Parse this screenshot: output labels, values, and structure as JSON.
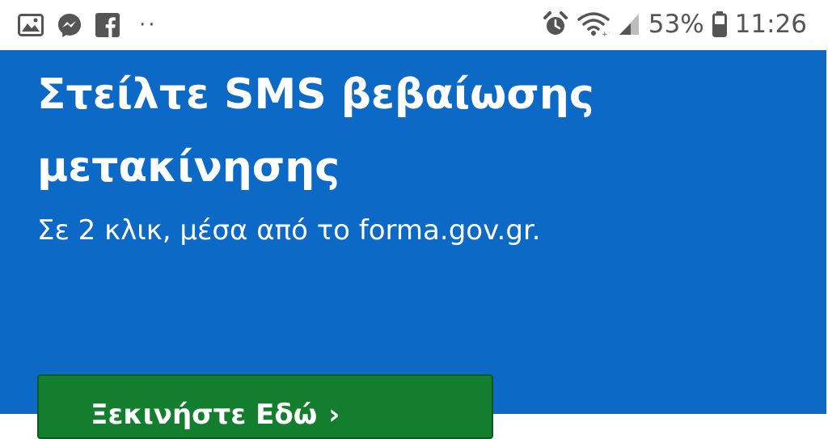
{
  "status_bar": {
    "left_icons": [
      "image-icon",
      "messenger-icon",
      "facebook-icon",
      "more-dots-icon"
    ],
    "more_dots": "··",
    "right_icons": [
      "alarm-icon",
      "wifi-icon",
      "signal-icon",
      "battery-icon"
    ],
    "battery_percent": "53%",
    "time": "11:26"
  },
  "hero": {
    "title": "Στείλτε SMS βεβαίωσης μετακίνησης",
    "subtitle": "Σε 2 κλικ, μέσα από το forma.gov.gr.",
    "cta_label": "Ξεκινήστε Εδώ",
    "cta_arrow": "›"
  },
  "colors": {
    "hero_bg": "#0d69c6",
    "cta_bg": "#137e2e",
    "text_on_hero": "#ffffff",
    "status_icons": "#555555"
  }
}
